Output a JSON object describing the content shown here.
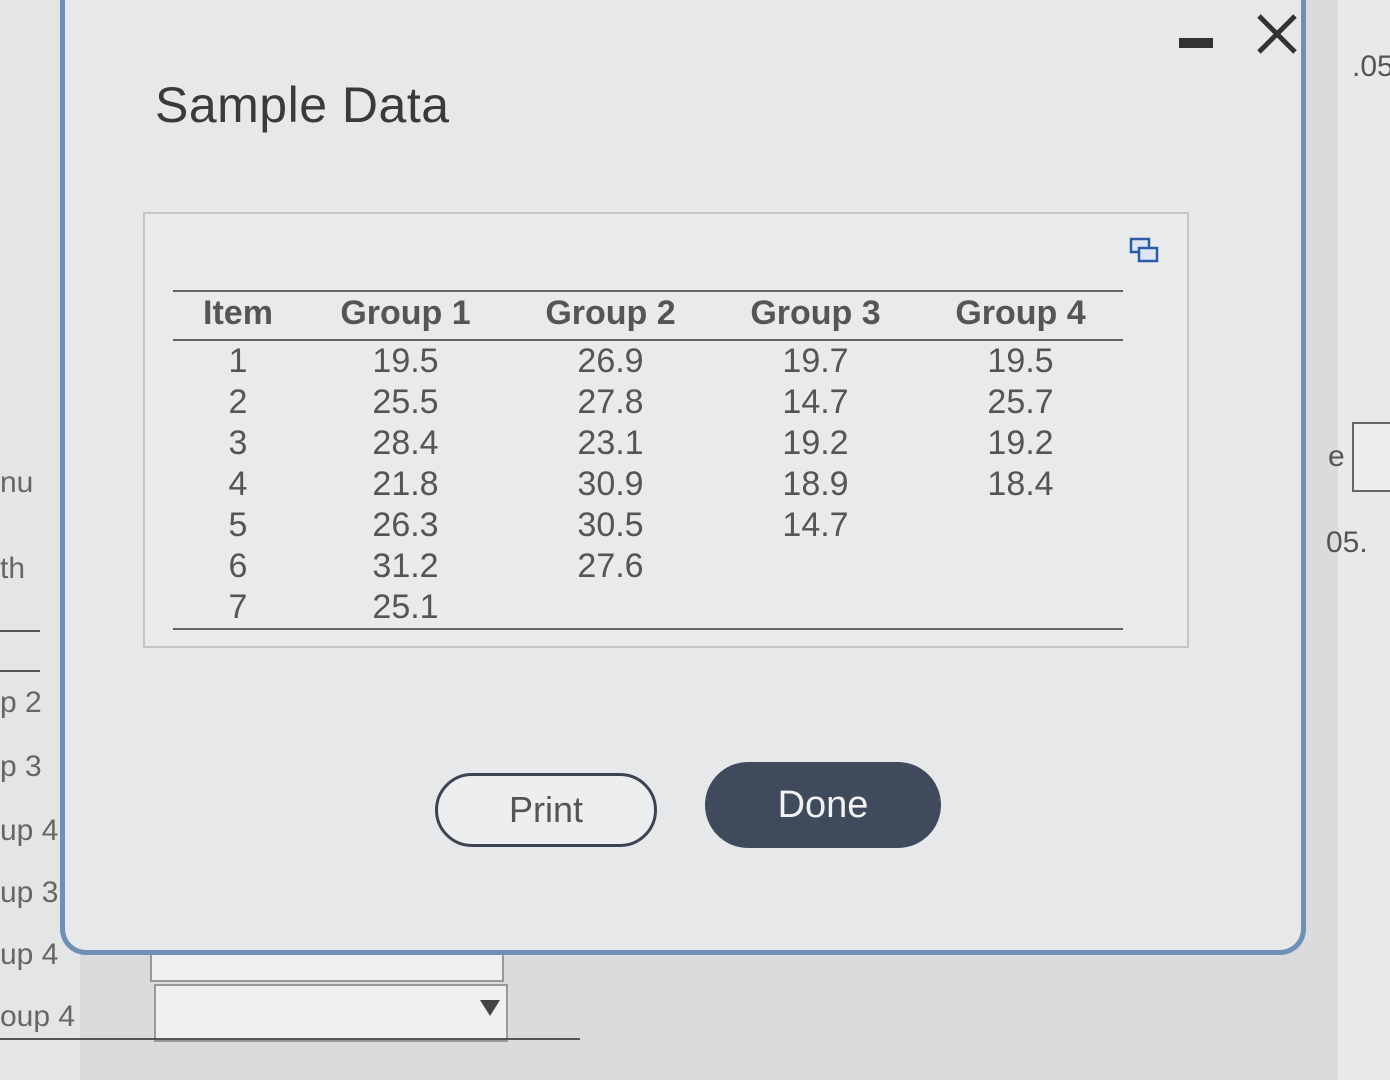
{
  "background": {
    "left_labels": [
      "nu",
      "th",
      "p 2",
      "p 3",
      "up 4",
      "up 3",
      "up 4",
      "oup 4"
    ],
    "right_labels": [
      ".05",
      "e",
      "05."
    ]
  },
  "dialog": {
    "title": "Sample Data",
    "minimize_icon": "minimize-icon",
    "close_icon": "close-icon",
    "popout_icon": "popout-icon"
  },
  "table": {
    "headers": [
      "Item",
      "Group 1",
      "Group 2",
      "Group 3",
      "Group 4"
    ],
    "rows": [
      [
        "1",
        "19.5",
        "26.9",
        "19.7",
        "19.5"
      ],
      [
        "2",
        "25.5",
        "27.8",
        "14.7",
        "25.7"
      ],
      [
        "3",
        "28.4",
        "23.1",
        "19.2",
        "19.2"
      ],
      [
        "4",
        "21.8",
        "30.9",
        "18.9",
        "18.4"
      ],
      [
        "5",
        "26.3",
        "30.5",
        "14.7",
        ""
      ],
      [
        "6",
        "31.2",
        "27.6",
        "",
        ""
      ],
      [
        "7",
        "25.1",
        "",
        "",
        ""
      ]
    ]
  },
  "buttons": {
    "print": "Print",
    "done": "Done"
  }
}
